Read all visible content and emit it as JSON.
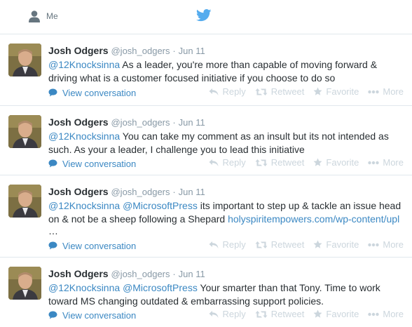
{
  "topbar": {
    "me_label": "Me"
  },
  "colors": {
    "link": "#3b88c3",
    "muted": "#8899a6",
    "action": "#ccd6dd",
    "bird": "#55acee"
  },
  "tweets": [
    {
      "name": "Josh Odgers",
      "handle": "@josh_odgers",
      "sep": "·",
      "time": "Jun 11",
      "mention1": "@12Knocksinna",
      "text": " As a leader, you're more than capable of moving forward & driving what is a customer focused initiative if you choose to do so",
      "view": "View conversation",
      "reply": "Reply",
      "retweet": "Retweet",
      "favorite": "Favorite",
      "more": "More"
    },
    {
      "name": "Josh Odgers",
      "handle": "@josh_odgers",
      "sep": "·",
      "time": "Jun 11",
      "mention1": "@12Knocksinna",
      "text": " You can take my comment as an insult but its not intended as such. As your a leader, I challenge you to lead this initiative",
      "view": "View conversation",
      "reply": "Reply",
      "retweet": "Retweet",
      "favorite": "Favorite",
      "more": "More"
    },
    {
      "name": "Josh Odgers",
      "handle": "@josh_odgers",
      "sep": "·",
      "time": "Jun 11",
      "mention1": "@12Knocksinna",
      "mention2": "@MicrosoftPress",
      "text": " its important to step up & tackle an issue head on & not be a sheep following a Shepard ",
      "link": "holyspiritempowers.com/wp-content/upl",
      "ellipsis": "…",
      "view": "View conversation",
      "reply": "Reply",
      "retweet": "Retweet",
      "favorite": "Favorite",
      "more": "More"
    },
    {
      "name": "Josh Odgers",
      "handle": "@josh_odgers",
      "sep": "·",
      "time": "Jun 11",
      "mention1": "@12Knocksinna",
      "mention2": "@MicrosoftPress",
      "text": " Your smarter than that Tony. Time to work toward MS changing outdated & embarrassing support policies.",
      "view": "View conversation",
      "reply": "Reply",
      "retweet": "Retweet",
      "favorite": "Favorite",
      "more": "More"
    }
  ]
}
